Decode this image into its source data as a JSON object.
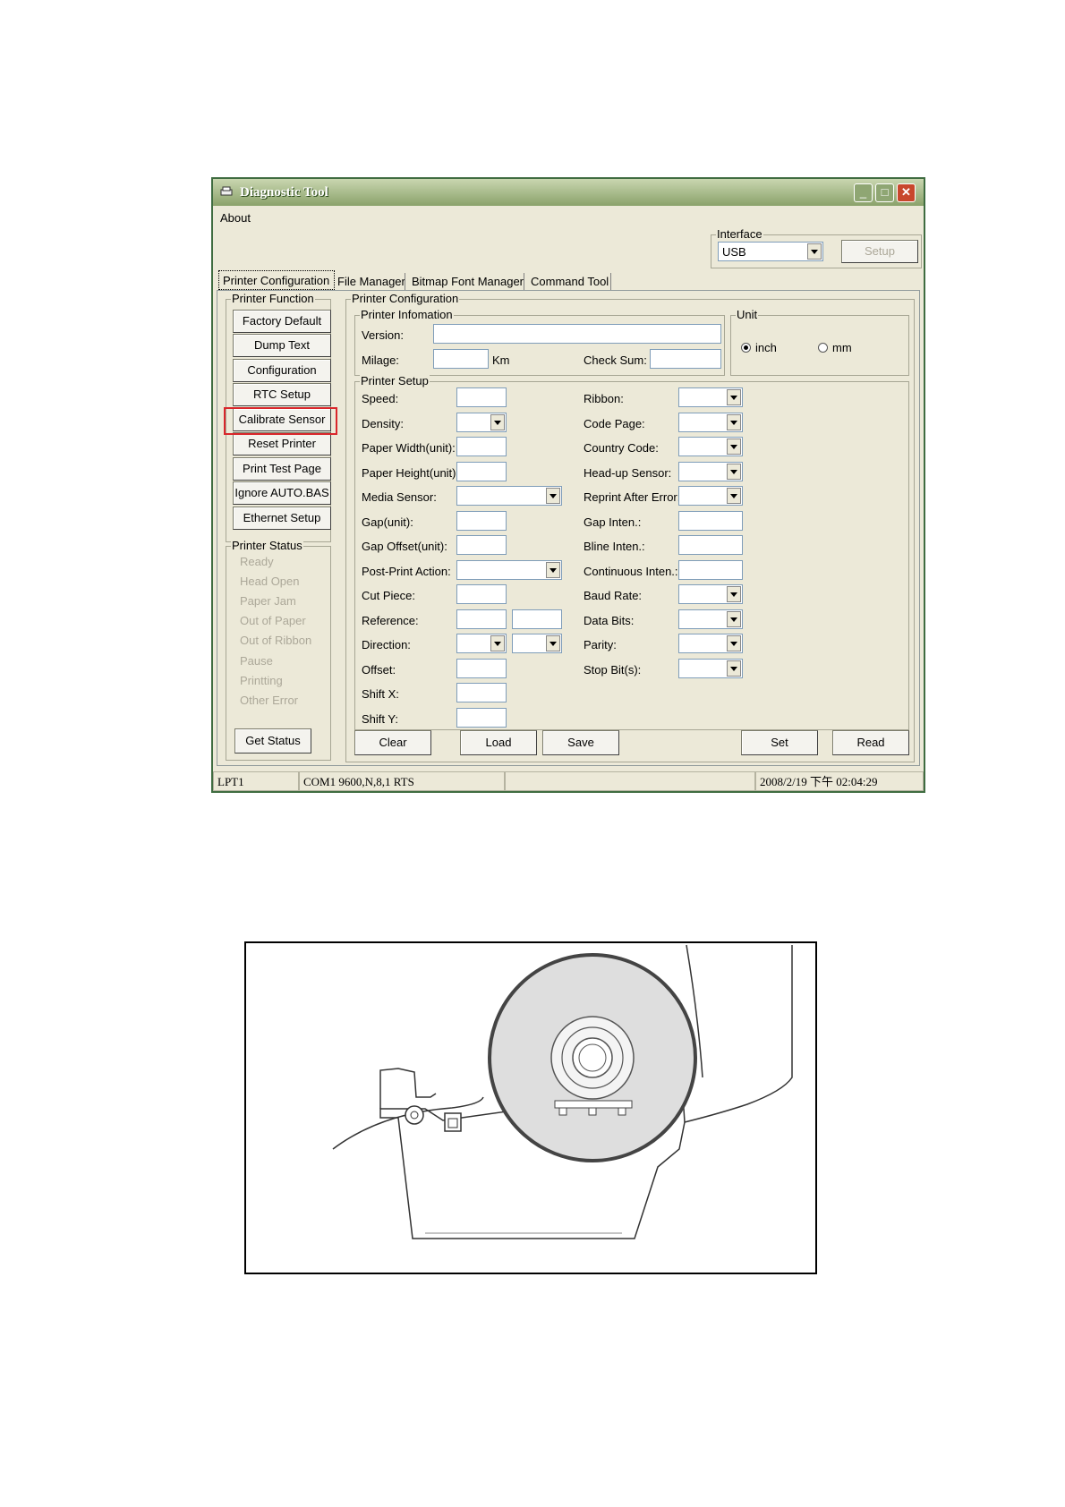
{
  "window": {
    "title": "Diagnostic Tool"
  },
  "menu": {
    "about": "About"
  },
  "interface": {
    "label": "Interface",
    "value": "USB",
    "setup": "Setup"
  },
  "tabs": [
    "Printer Configuration",
    "File Manager",
    "Bitmap Font Manager",
    "Command Tool"
  ],
  "printer_function": {
    "label": "Printer Function",
    "buttons": [
      "Factory Default",
      "Dump Text",
      "Configuration Page",
      "RTC Setup",
      "Calibrate Sensor",
      "Reset Printer",
      "Print Test Page",
      "Ignore AUTO.BAS",
      "Ethernet Setup"
    ]
  },
  "printer_status": {
    "label": "Printer Status",
    "items": [
      "Ready",
      "Head Open",
      "Paper Jam",
      "Out of Paper",
      "Out of Ribbon",
      "Pause",
      "Printting",
      "Other Error"
    ],
    "get_status": "Get Status"
  },
  "config": {
    "label": "Printer Configuration",
    "info": {
      "label": "Printer Infomation",
      "version": "Version:",
      "milage": "Milage:",
      "km": "Km",
      "checksum": "Check Sum:"
    },
    "unit": {
      "label": "Unit",
      "inch": "inch",
      "mm": "mm"
    },
    "setup": {
      "label": "Printer Setup",
      "left": [
        "Speed:",
        "Density:",
        "Paper Width(unit):",
        "Paper Height(unit):",
        "Media Sensor:",
        "Gap(unit):",
        "Gap Offset(unit):",
        "Post-Print Action:",
        "Cut Piece:",
        "Reference:",
        "Direction:",
        "Offset:",
        "Shift X:",
        "Shift Y:"
      ],
      "right": [
        "Ribbon:",
        "Code Page:",
        "Country Code:",
        "Head-up Sensor:",
        "Reprint After Error:",
        "Gap Inten.:",
        "Bline Inten.:",
        "Continuous Inten.:",
        "Baud Rate:",
        "Data Bits:",
        "Parity:",
        "Stop Bit(s):"
      ]
    },
    "buttons": {
      "clear": "Clear",
      "load": "Load",
      "save": "Save",
      "set": "Set",
      "read": "Read"
    }
  },
  "statusbar": {
    "port1": "LPT1",
    "port2": "COM1 9600,N,8,1 RTS",
    "datetime": "2008/2/19 下午 02:04:29"
  },
  "figure": {
    "label_text": "label roll"
  }
}
